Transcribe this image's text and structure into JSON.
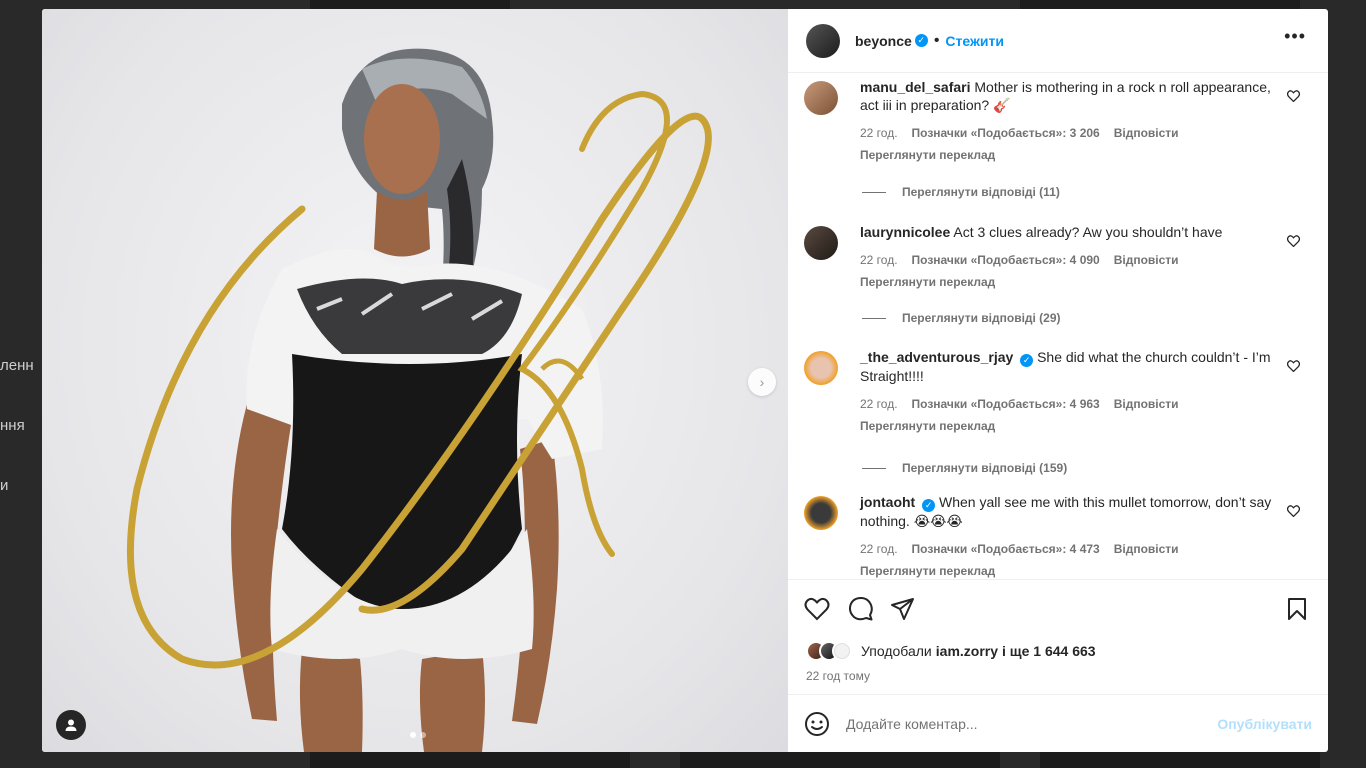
{
  "background": {
    "sidebar_fragments": [
      "ленн",
      "ння",
      "и"
    ]
  },
  "post": {
    "author": "beyonce",
    "follow_label": "Стежити",
    "more_label": "•••",
    "verified_mark": "✓"
  },
  "comments": [
    {
      "user": "manu_del_safari",
      "verified": false,
      "text": "Mother is mothering in a rock n roll appearance, act iii in preparation? 🎸",
      "time": "22 год.",
      "likes": "Позначки «Подобається»: 3 206",
      "reply_label": "Відповісти",
      "translate_label": "Переглянути переклад",
      "replies_label": "Переглянути відповіді (11)"
    },
    {
      "user": "laurynnicolee",
      "verified": false,
      "text": "Act 3 clues already? Aw you shouldn’t have",
      "time": "22 год.",
      "likes": "Позначки «Подобається»: 4 090",
      "reply_label": "Відповісти",
      "translate_label": "Переглянути переклад",
      "replies_label": "Переглянути відповіді (29)"
    },
    {
      "user": "_the_adventurous_rjay",
      "verified": true,
      "text": "She did what the church couldn’t - I’m Straight!!!!",
      "time": "22 год.",
      "likes": "Позначки «Подобається»: 4 963",
      "reply_label": "Відповісти",
      "translate_label": "Переглянути переклад",
      "replies_label": "Переглянути відповіді (159)"
    },
    {
      "user": "jontaoht",
      "verified": true,
      "text": "When yall see me with this mullet tomorrow, don’t say nothing. 😭😭😭",
      "time": "22 год.",
      "likes": "Позначки «Подобається»: 4 473",
      "reply_label": "Відповісти",
      "translate_label": "Переглянути переклад",
      "replies_label": ""
    }
  ],
  "actions": {
    "like_icon": "heart-icon",
    "comment_icon": "comment-icon",
    "share_icon": "share-icon",
    "save_icon": "bookmark-icon"
  },
  "likes": {
    "prefix": "Уподобали",
    "user": "iam.zorry",
    "suffix": "і ще 1 644 663"
  },
  "time_ago": "22 год тому",
  "comment_box": {
    "placeholder": "Додайте коментар...",
    "publish_label": "Опублікувати"
  },
  "carousel": {
    "next_icon": "›",
    "slide_count": 2,
    "active_slide": 1
  },
  "colors": {
    "accent": "#0095f6",
    "publish_disabled": "#b2dffc",
    "muted_text": "#737373",
    "gold": "#c9a235"
  }
}
